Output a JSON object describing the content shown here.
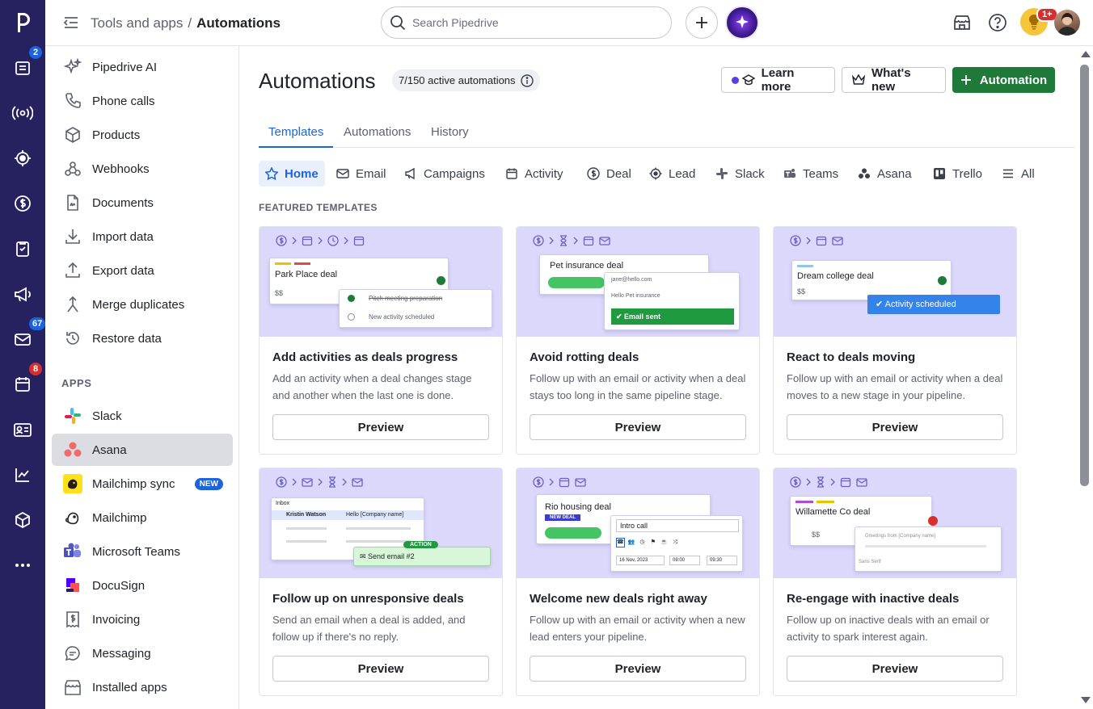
{
  "topbar": {
    "breadcrumb_parent": "Tools and apps",
    "breadcrumb_sep": "/",
    "breadcrumb_current": "Automations",
    "search_placeholder": "Search Pipedrive",
    "notifications_badge": "1+"
  },
  "rail": {
    "badges": {
      "deals": "2",
      "mail": "67",
      "calendar": "8"
    },
    "colors": {
      "background": "#26225f",
      "badge_blue": "#1b64de",
      "badge_red": "#d62f2f"
    }
  },
  "sidebar": {
    "tools": [
      {
        "label": "Pipedrive AI",
        "icon": "sparkles-icon"
      },
      {
        "label": "Phone calls",
        "icon": "phone-icon"
      },
      {
        "label": "Products",
        "icon": "box-icon"
      },
      {
        "label": "Webhooks",
        "icon": "webhook-icon"
      },
      {
        "label": "Documents",
        "icon": "document-icon"
      },
      {
        "label": "Import data",
        "icon": "import-icon"
      },
      {
        "label": "Export data",
        "icon": "export-icon"
      },
      {
        "label": "Merge duplicates",
        "icon": "merge-icon"
      },
      {
        "label": "Restore data",
        "icon": "restore-icon"
      }
    ],
    "apps_header": "APPS",
    "apps": [
      {
        "label": "Slack",
        "icon": "slack-icon"
      },
      {
        "label": "Asana",
        "icon": "asana-icon",
        "active": true
      },
      {
        "label": "Mailchimp sync",
        "icon": "mailchimp-icon",
        "badge": "NEW"
      },
      {
        "label": "Mailchimp",
        "icon": "mailchimp-icon"
      },
      {
        "label": "Microsoft Teams",
        "icon": "teams-icon"
      },
      {
        "label": "DocuSign",
        "icon": "docusign-icon"
      },
      {
        "label": "Invoicing",
        "icon": "invoice-icon"
      },
      {
        "label": "Messaging",
        "icon": "chat-icon"
      },
      {
        "label": "Installed apps",
        "icon": "store-icon"
      }
    ]
  },
  "main": {
    "title": "Automations",
    "active_count": "7/150 active automations",
    "learn_more": "Learn more",
    "whats_new": "What's new",
    "add_automation": "Automation",
    "tabs": [
      {
        "label": "Templates",
        "active": true
      },
      {
        "label": "Automations"
      },
      {
        "label": "History"
      }
    ],
    "categories": [
      {
        "label": "Home",
        "active": true
      },
      {
        "label": "Email"
      },
      {
        "label": "Campaigns"
      },
      {
        "label": "Activity"
      },
      {
        "label": "Deal"
      },
      {
        "label": "Lead"
      },
      {
        "label": "Slack"
      },
      {
        "label": "Teams"
      },
      {
        "label": "Asana"
      },
      {
        "label": "Trello"
      },
      {
        "label": "All"
      }
    ],
    "featured_heading": "FEATURED TEMPLATES",
    "preview_label": "Preview",
    "cards": [
      {
        "title": "Add activities as deals progress",
        "desc": "Add an activity when a deal changes stage and another when the last one is done.",
        "mock": {
          "deal": "Park Place deal",
          "amount": "$$",
          "line1": "Pitch meeting preparation",
          "line2": "New activity scheduled"
        }
      },
      {
        "title": "Avoid rotting deals",
        "desc": "Follow up with an email or activity when a deal stays too long in the same pipeline stage.",
        "mock": {
          "deal": "Pet insurance deal",
          "email": "jane@hello.com",
          "subject": "Hello Pet insurance",
          "status": "Email sent"
        }
      },
      {
        "title": "React to deals moving",
        "desc": "Follow up with an email or activity when a deal moves to a new stage in your pipeline.",
        "mock": {
          "deal": "Dream college deal",
          "amount": "$$",
          "status": "Activity scheduled"
        }
      },
      {
        "title": "Follow up on unresponsive deals",
        "desc": "Send an email when a deal is added, and follow up if there's no reply.",
        "mock": {
          "inbox": "Inbox",
          "contact": "Kristin Watson",
          "subject": "Hello [Company name]",
          "tag": "ACTION",
          "action": "Send email #2"
        }
      },
      {
        "title": "Welcome new deals right away",
        "desc": "Follow up with an email or activity when a new lead enters your pipeline.",
        "mock": {
          "deal": "Rio housing deal",
          "tag": "NEW DEAL",
          "activity": "Intro call",
          "date": "16 Nov, 2023",
          "from": "09:00",
          "to": "09:30"
        }
      },
      {
        "title": "Re-engage with inactive deals",
        "desc": "Follow up on inactive deals with an email or activity to spark interest again.",
        "mock": {
          "deal": "Willamette Co deal",
          "amount": "$$",
          "greeting": "Greetings from [Company name]",
          "font": "Sans Serif"
        }
      }
    ]
  },
  "colors": {
    "primary_green": "#1f7a3a",
    "accent_blue": "#1b64de",
    "card_illustration": "#dcd8fb"
  }
}
